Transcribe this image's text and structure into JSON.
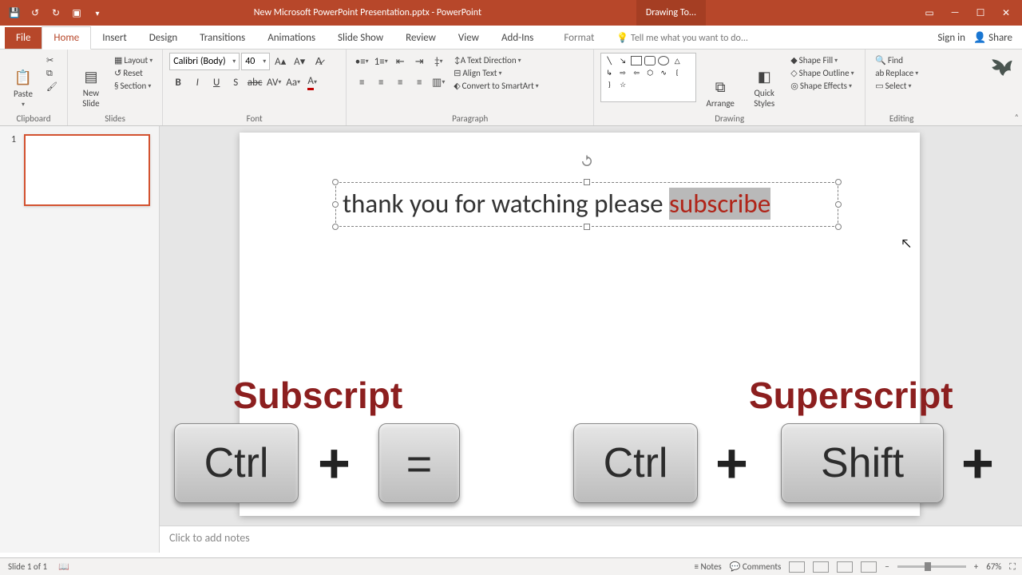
{
  "window": {
    "title": "New Microsoft PowerPoint Presentation.pptx - PowerPoint",
    "contextual_tab": "Drawing To..."
  },
  "menubar": {
    "file": "File",
    "tabs": [
      "Home",
      "Insert",
      "Design",
      "Transitions",
      "Animations",
      "Slide Show",
      "Review",
      "View",
      "Add-Ins",
      "Format"
    ],
    "active_index": 0,
    "tell_me_placeholder": "Tell me what you want to do...",
    "sign_in": "Sign in",
    "share": "Share"
  },
  "ribbon": {
    "clipboard": {
      "label": "Clipboard",
      "paste": "Paste"
    },
    "slides": {
      "label": "Slides",
      "new_slide": "New\nSlide",
      "layout": "Layout",
      "reset": "Reset",
      "section": "Section"
    },
    "font": {
      "label": "Font",
      "name": "Calibri (Body)",
      "size": "40"
    },
    "paragraph": {
      "label": "Paragraph",
      "text_direction": "Text Direction",
      "align_text": "Align Text",
      "convert": "Convert to SmartArt"
    },
    "drawing": {
      "label": "Drawing",
      "arrange": "Arrange",
      "quick_styles": "Quick\nStyles",
      "shape_fill": "Shape Fill",
      "shape_outline": "Shape Outline",
      "shape_effects": "Shape Effects"
    },
    "editing": {
      "label": "Editing",
      "find": "Find",
      "replace": "Replace",
      "select": "Select"
    }
  },
  "thumbs": {
    "one": "1"
  },
  "slide_textbox": {
    "part1": "thank you for watching please ",
    "selection": "subscribe"
  },
  "overlay": {
    "subscript_label": "Subscript",
    "superscript_label": "Superscript",
    "ctrl": "Ctrl",
    "shift": "Shift",
    "eq": "=",
    "plus": "+"
  },
  "notes_placeholder": "Click to add notes",
  "status": {
    "slide": "Slide 1 of 1",
    "notes": "Notes",
    "comments": "Comments",
    "zoom": "67%"
  }
}
